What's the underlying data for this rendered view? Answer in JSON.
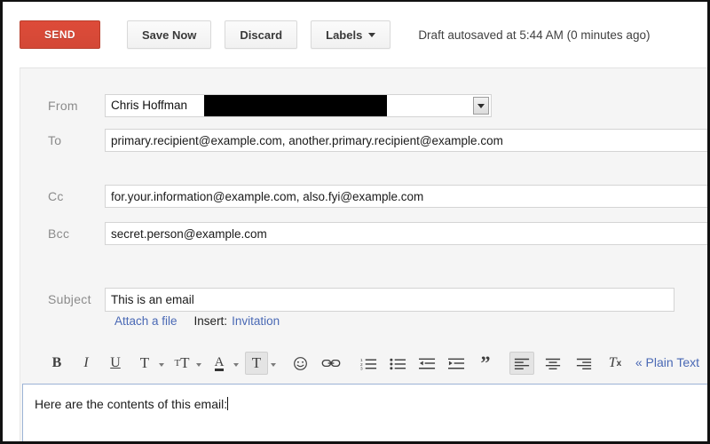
{
  "window": {
    "accent_red": "#d84a34",
    "link_blue": "#4a69b5",
    "panel_bg": "#f5f5f5"
  },
  "action_bar": {
    "send_label": "SEND",
    "save_label": "Save Now",
    "discard_label": "Discard",
    "labels_label": "Labels",
    "autosave_status": "Draft autosaved at 5:44 AM (0 minutes ago)"
  },
  "fields": {
    "from": {
      "label": "From",
      "value": "Chris Hoffman",
      "redacted": true
    },
    "to": {
      "label": "To",
      "value": "primary.recipient@example.com, another.primary.recipient@example.com"
    },
    "cc": {
      "label": "Cc",
      "value": "for.your.information@example.com, also.fyi@example.com"
    },
    "bcc": {
      "label": "Bcc",
      "value": "secret.person@example.com"
    },
    "subject": {
      "label": "Subject",
      "value": "This is an email"
    }
  },
  "attach_row": {
    "attach_label": "Attach a file",
    "insert_label": "Insert:",
    "invitation_label": "Invitation"
  },
  "format_toolbar": {
    "bold": "B",
    "italic": "I",
    "underline": "U",
    "font_family": "T",
    "font_size": "T",
    "text_color": "A",
    "highlight_color": "T",
    "plain_text_label": "« Plain Text",
    "items": [
      "bold-icon",
      "italic-icon",
      "underline-icon",
      "font-family-icon",
      "font-size-icon",
      "text-color-icon",
      "highlight-color-icon",
      "emoji-icon",
      "link-icon",
      "numbered-list-icon",
      "bulleted-list-icon",
      "outdent-icon",
      "indent-icon",
      "quote-icon",
      "align-left-icon",
      "align-center-icon",
      "align-right-icon",
      "remove-formatting-icon"
    ],
    "active_item": "align-left-icon"
  },
  "body": {
    "text": "Here are the contents of this email:"
  }
}
